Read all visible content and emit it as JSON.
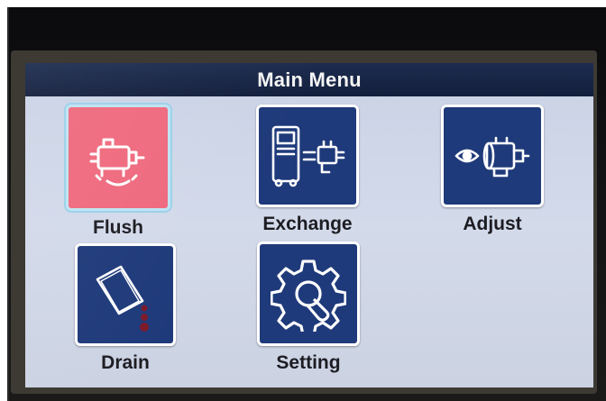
{
  "window": {
    "title": "Main Menu"
  },
  "menu": {
    "items": [
      {
        "label": "Flush",
        "icon": "flush-icon",
        "selected": true,
        "color": "#ef6a7e"
      },
      {
        "label": "Exchange",
        "icon": "exchange-icon",
        "selected": false,
        "color": "#1f3a7a"
      },
      {
        "label": "Adjust",
        "icon": "adjust-icon",
        "selected": false,
        "color": "#1f3a7a"
      },
      {
        "label": "Drain",
        "icon": "drain-icon",
        "selected": false,
        "color": "#1f3a7a"
      },
      {
        "label": "Setting",
        "icon": "gear-icon",
        "selected": false,
        "color": "#1f3a7a"
      }
    ]
  },
  "colors": {
    "titlebar": "#16244a",
    "screen_bg": "#cfd6e6",
    "icon_tile": "#1f3a7a",
    "selected_tile": "#ef6a7e"
  }
}
